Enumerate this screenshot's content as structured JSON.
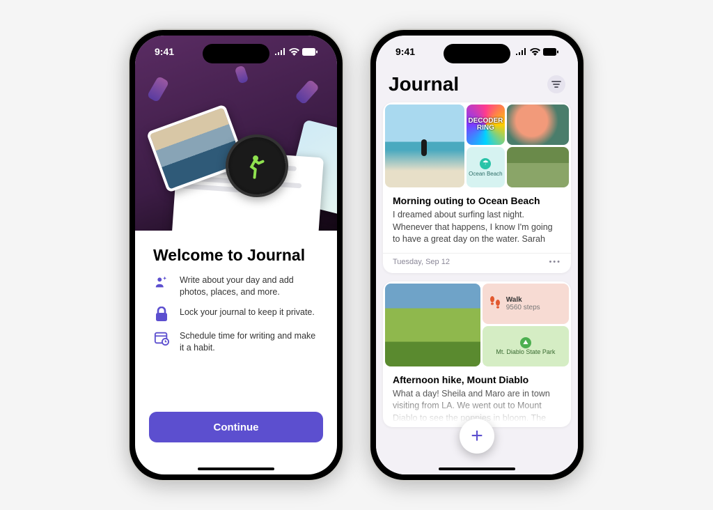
{
  "status": {
    "time": "9:41"
  },
  "welcome": {
    "title": "Welcome to Journal",
    "features": [
      "Write about your day and add photos, places, and more.",
      "Lock your journal to keep it private.",
      "Schedule time for writing and make it a habit."
    ],
    "cta": "Continue"
  },
  "journal": {
    "header": "Journal",
    "entries": [
      {
        "title": "Morning outing to Ocean Beach",
        "text": "I dreamed about surfing last night. Whenever that happens, I know I'm going to have a great day on the water. Sarah",
        "date": "Tuesday, Sep 12",
        "podcast_label": "DECODER RING",
        "location_label": "Ocean Beach"
      },
      {
        "title": "Afternoon hike, Mount Diablo",
        "text": "What a day! Sheila and Maro are in town visiting from LA. We went out to Mount Diablo to see the poppies in bloom. The",
        "walk_label": "Walk",
        "walk_steps": "9560 steps",
        "park_label": "Mt. Diablo State Park"
      }
    ]
  }
}
